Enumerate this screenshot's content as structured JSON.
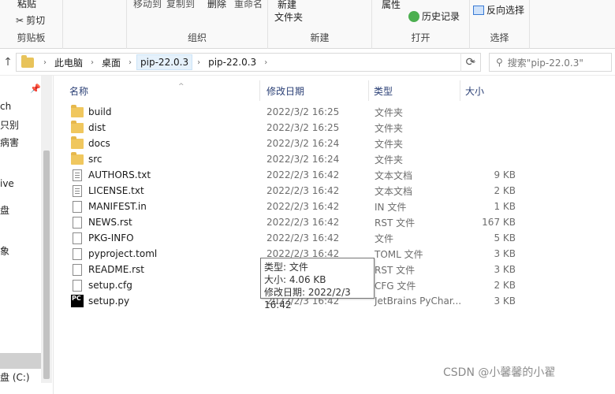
{
  "ribbon": {
    "clipboard": {
      "paste": "粘贴",
      "cut": "剪切",
      "label": "剪贴板"
    },
    "organize": {
      "move_to": "移动到",
      "copy_to": "复制到",
      "delete": "删除",
      "rename": "重命名",
      "label": "组织"
    },
    "new": {
      "new_folder_line1": "新建",
      "new_folder_line2": "文件夹",
      "label": "新建"
    },
    "open": {
      "properties": "属性",
      "history": "历史记录",
      "label": "打开"
    },
    "select": {
      "invert": "反向选择",
      "label": "选择"
    }
  },
  "address": {
    "crumbs": [
      "此电脑",
      "桌面",
      "pip-22.0.3",
      "pip-22.0.3"
    ],
    "search_placeholder": "搜索\"pip-22.0.3\""
  },
  "nav": {
    "items": [
      "ch",
      "只别",
      "病害",
      "ive",
      "盘",
      "象",
      "盘 (C:)"
    ]
  },
  "columns": {
    "name": "名称",
    "date": "修改日期",
    "type": "类型",
    "size": "大小"
  },
  "files": [
    {
      "name": "build",
      "date": "2022/3/2 16:25",
      "type": "文件夹",
      "size": "",
      "icon": "folder-icon"
    },
    {
      "name": "dist",
      "date": "2022/3/2 16:25",
      "type": "文件夹",
      "size": "",
      "icon": "folder-icon"
    },
    {
      "name": "docs",
      "date": "2022/3/2 16:24",
      "type": "文件夹",
      "size": "",
      "icon": "folder-icon"
    },
    {
      "name": "src",
      "date": "2022/3/2 16:24",
      "type": "文件夹",
      "size": "",
      "icon": "folder-icon"
    },
    {
      "name": "AUTHORS.txt",
      "date": "2022/2/3 16:42",
      "type": "文本文档",
      "size": "9 KB",
      "icon": "text-file-icon"
    },
    {
      "name": "LICENSE.txt",
      "date": "2022/2/3 16:42",
      "type": "文本文档",
      "size": "2 KB",
      "icon": "text-file-icon"
    },
    {
      "name": "MANIFEST.in",
      "date": "2022/2/3 16:42",
      "type": "IN 文件",
      "size": "1 KB",
      "icon": "file-icon"
    },
    {
      "name": "NEWS.rst",
      "date": "2022/2/3 16:42",
      "type": "RST 文件",
      "size": "167 KB",
      "icon": "file-icon"
    },
    {
      "name": "PKG-INFO",
      "date": "2022/2/3 16:42",
      "type": "文件",
      "size": "5 KB",
      "icon": "file-icon"
    },
    {
      "name": "pyproject.toml",
      "date": "2022/2/3 16:42",
      "type": "TOML 文件",
      "size": "3 KB",
      "icon": "file-icon"
    },
    {
      "name": "README.rst",
      "date": "2022/2/3 16:42",
      "type": "RST 文件",
      "size": "3 KB",
      "icon": "file-icon"
    },
    {
      "name": "setup.cfg",
      "date": "2022/2/3 16:42",
      "type": "CFG 文件",
      "size": "2 KB",
      "icon": "file-icon"
    },
    {
      "name": "setup.py",
      "date": "2022/2/3 16:42",
      "type": "JetBrains PyChar...",
      "size": "3 KB",
      "icon": "pycharm-icon"
    }
  ],
  "tooltip": {
    "type": "类型: 文件",
    "size": "大小: 4.06 KB",
    "date": "修改日期: 2022/2/3 16:42"
  },
  "watermark": "CSDN @小馨馨的小翟"
}
